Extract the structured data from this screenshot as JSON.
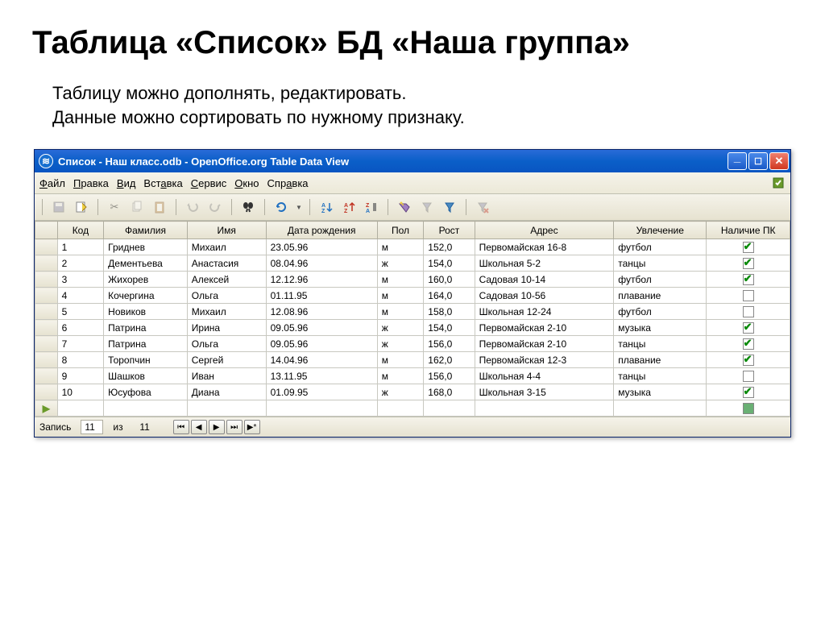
{
  "slide": {
    "title": "Таблица «Список»  БД «Наша группа»",
    "subtitle_line1": "Таблицу можно дополнять, редактировать.",
    "subtitle_line2": " Данные можно сортировать по нужному признаку."
  },
  "window_title": "Список - Наш класс.odb - OpenOffice.org Table Data View",
  "menu": {
    "file": "Файл",
    "edit": "Правка",
    "view": "Вид",
    "insert": "Вставка",
    "service": "Сервис",
    "window": "Окно",
    "help": "Справка"
  },
  "columns": {
    "id": "Код",
    "lastname": "Фамилия",
    "firstname": "Имя",
    "dob": "Дата рождения",
    "sex": "Пол",
    "height": "Рост",
    "address": "Адрес",
    "hobby": "Увлечение",
    "haspc": "Наличие ПК"
  },
  "rows": [
    {
      "id": "1",
      "lastname": "Гриднев",
      "firstname": "Михаил",
      "dob": "23.05.96",
      "sex": "м",
      "height": "152,0",
      "address": "Первомайская 16-8",
      "hobby": "футбол",
      "haspc": true
    },
    {
      "id": "2",
      "lastname": "Дементьева",
      "firstname": "Анастасия",
      "dob": "08.04.96",
      "sex": "ж",
      "height": "154,0",
      "address": "Школьная 5-2",
      "hobby": "танцы",
      "haspc": true
    },
    {
      "id": "3",
      "lastname": "Жихорев",
      "firstname": "Алексей",
      "dob": "12.12.96",
      "sex": "м",
      "height": "160,0",
      "address": "Садовая 10-14",
      "hobby": "футбол",
      "haspc": true
    },
    {
      "id": "4",
      "lastname": "Кочергина",
      "firstname": "Ольга",
      "dob": "01.11.95",
      "sex": "м",
      "height": "164,0",
      "address": "Садовая 10-56",
      "hobby": "плавание",
      "haspc": false
    },
    {
      "id": "5",
      "lastname": "Новиков",
      "firstname": "Михаил",
      "dob": "12.08.96",
      "sex": "м",
      "height": "158,0",
      "address": "Школьная 12-24",
      "hobby": "футбол",
      "haspc": false
    },
    {
      "id": "6",
      "lastname": "Патрина",
      "firstname": "Ирина",
      "dob": "09.05.96",
      "sex": "ж",
      "height": "154,0",
      "address": "Первомайская 2-10",
      "hobby": "музыка",
      "haspc": true
    },
    {
      "id": "7",
      "lastname": "Патрина",
      "firstname": "Ольга",
      "dob": "09.05.96",
      "sex": "ж",
      "height": "156,0",
      "address": "Первомайская 2-10",
      "hobby": "танцы",
      "haspc": true
    },
    {
      "id": "8",
      "lastname": "Торопчин",
      "firstname": "Сергей",
      "dob": "14.04.96",
      "sex": "м",
      "height": "162,0",
      "address": "Первомайская 12-3",
      "hobby": "плавание",
      "haspc": true
    },
    {
      "id": "9",
      "lastname": "Шашков",
      "firstname": "Иван",
      "dob": "13.11.95",
      "sex": "м",
      "height": "156,0",
      "address": "Школьная 4-4",
      "hobby": "танцы",
      "haspc": false
    },
    {
      "id": "10",
      "lastname": "Юсуфова",
      "firstname": "Диана",
      "dob": "01.09.95",
      "sex": "ж",
      "height": "168,0",
      "address": "Школьная 3-15",
      "hobby": "музыка",
      "haspc": true
    }
  ],
  "status": {
    "record_label": "Запись",
    "current": "11",
    "of_label": "из",
    "total": "11"
  }
}
